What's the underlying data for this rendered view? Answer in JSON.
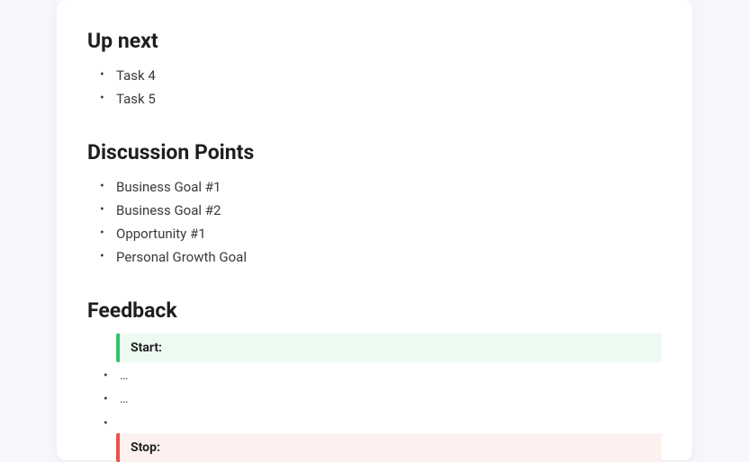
{
  "sections": {
    "upnext": {
      "title": "Up next",
      "items": [
        "Task 4",
        "Task 5"
      ]
    },
    "discussion": {
      "title": "Discussion Points",
      "items": [
        "Business Goal #1",
        "Business Goal #2",
        "Opportunity #1",
        "Personal Growth Goal"
      ]
    },
    "feedback": {
      "title": "Feedback",
      "start_label": "Start:",
      "start_items": [
        "…",
        "…",
        ""
      ],
      "stop_label": "Stop:"
    }
  }
}
